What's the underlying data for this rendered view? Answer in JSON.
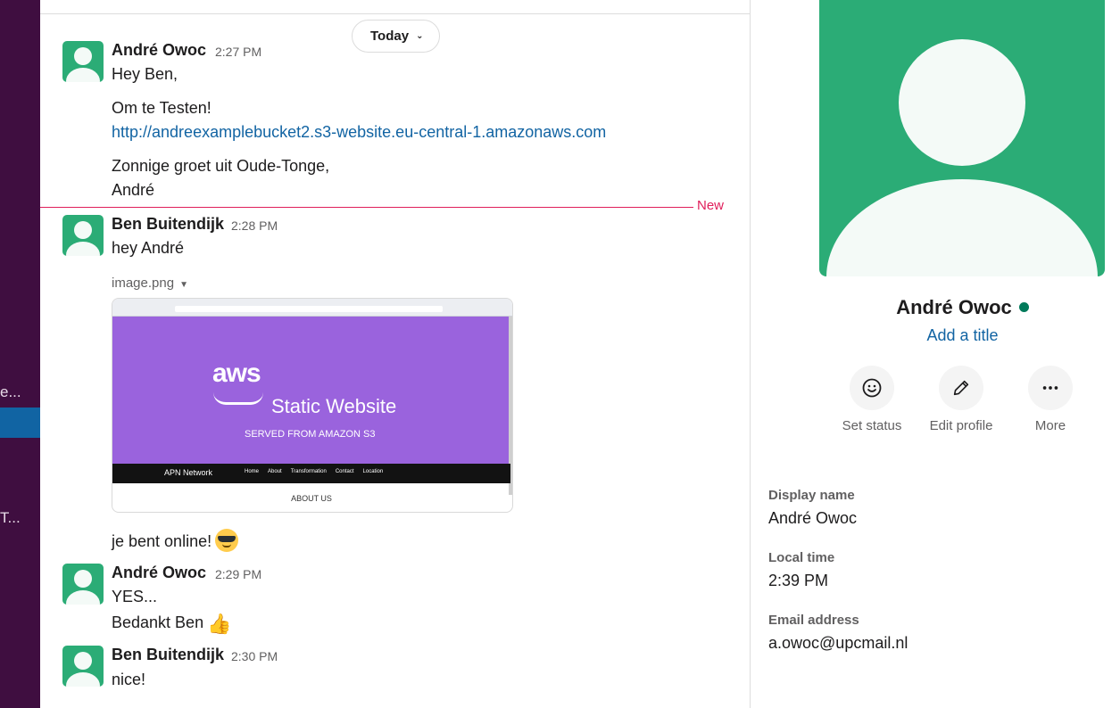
{
  "sidebar": {
    "truncated_item_1": "e...",
    "truncated_item_2": "T..."
  },
  "messages": {
    "date_divider": "Today",
    "new_label": "New",
    "items": [
      {
        "author": "André Owoc",
        "time": "2:27 PM",
        "lines": [
          "Hey Ben,",
          "Om te Testen!"
        ],
        "link": "http://andreexamplebucket2.s3-website.eu-central-1.amazonaws.com",
        "closing": [
          "Zonnige groet uit Oude-Tonge,",
          "André"
        ]
      },
      {
        "author": "Ben Buitendijk",
        "time": "2:28 PM",
        "text": "hey André",
        "file_name": "image.png",
        "caption": "je bent online!"
      },
      {
        "author": "André Owoc",
        "time": "2:29 PM",
        "lines": [
          "YES...",
          "Bedankt Ben"
        ]
      },
      {
        "author": "Ben Buitendijk",
        "time": "2:30 PM",
        "text": "nice!"
      }
    ],
    "preview": {
      "logo": "aws",
      "title": "Static Website",
      "subtitle": "SERVED FROM AMAZON S3",
      "nav_brand": "APN Network",
      "nav_links": [
        "Home",
        "About",
        "Transformation",
        "Contact",
        "Location"
      ],
      "section": "ABOUT US"
    }
  },
  "profile": {
    "name": "André Owoc",
    "add_title": "Add a title",
    "actions": [
      {
        "label": "Set status",
        "icon": "smiley-icon"
      },
      {
        "label": "Edit profile",
        "icon": "pencil-icon"
      },
      {
        "label": "More",
        "icon": "ellipsis-icon"
      }
    ],
    "fields": {
      "display_name_label": "Display name",
      "display_name": "André Owoc",
      "local_time_label": "Local time",
      "local_time": "2:39 PM",
      "email_label": "Email address",
      "email": "a.owoc@upcmail.nl"
    }
  },
  "colors": {
    "sidebar_bg": "#3f0e40",
    "active_item": "#1164a3",
    "avatar_green": "#2bac76",
    "link_blue": "#1264a3",
    "new_red": "#e01e5a",
    "presence_green": "#007a5a"
  }
}
